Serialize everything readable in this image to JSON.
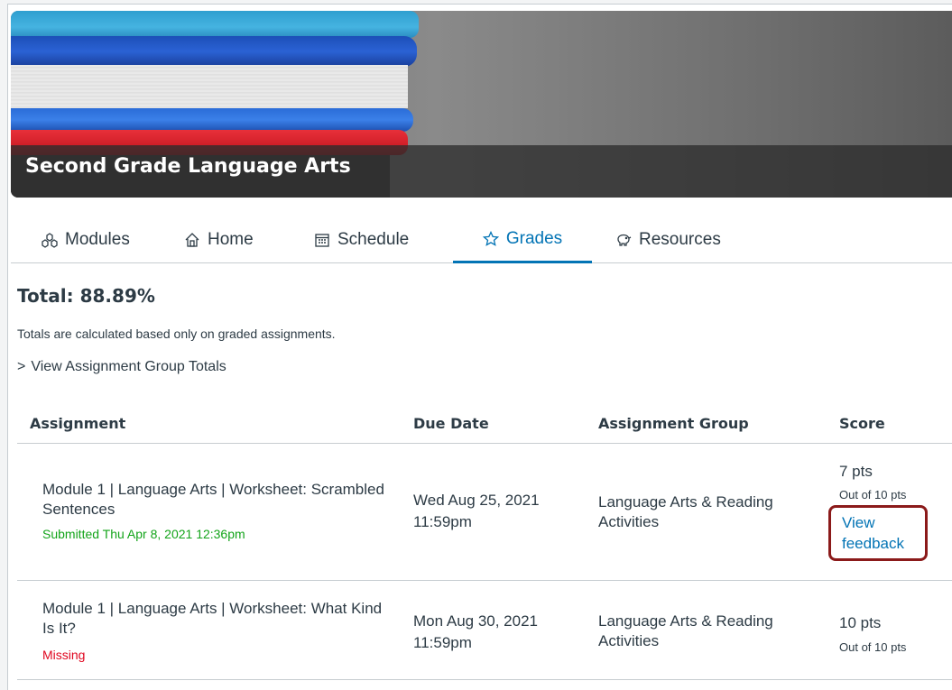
{
  "course": {
    "title": "Second Grade Language Arts"
  },
  "tabs": [
    {
      "label": "Modules",
      "icon": "modules-icon"
    },
    {
      "label": "Home",
      "icon": "home-icon"
    },
    {
      "label": "Schedule",
      "icon": "calendar-icon"
    },
    {
      "label": "Grades",
      "icon": "star-icon",
      "active": true
    },
    {
      "label": "Resources",
      "icon": "piggy-bank-icon"
    }
  ],
  "totals": {
    "total": "Total: 88.89%",
    "note": "Totals are calculated based only on graded assignments.",
    "group_toggle": "View Assignment Group Totals",
    "toggle_glyph": ">"
  },
  "table": {
    "headers": {
      "assignment": "Assignment",
      "due": "Due Date",
      "group": "Assignment Group",
      "score": "Score"
    },
    "rows": [
      {
        "title": "Module 1 | Language Arts | Worksheet: Scrambled Sentences",
        "status": "Submitted Thu Apr 8, 2021 12:36pm",
        "due_date": "Wed Aug 25, 2021",
        "due_time": "11:59pm",
        "group": "Language Arts & Reading Activities",
        "score": "7 pts",
        "out_of": "Out of 10 pts",
        "feedback": "View feedback"
      },
      {
        "title": "Module 1 | Language Arts | Worksheet: What Kind Is It?",
        "status": "Missing",
        "due_date": "Mon Aug 30, 2021",
        "due_time": "11:59pm",
        "group": "Language Arts & Reading Activities",
        "score": "10 pts",
        "out_of": "Out of 10 pts"
      }
    ]
  },
  "colors": {
    "accent": "#0374b5",
    "submitted": "#13a41a",
    "missing": "#e0061f",
    "highlight": "#8b1a1a"
  }
}
